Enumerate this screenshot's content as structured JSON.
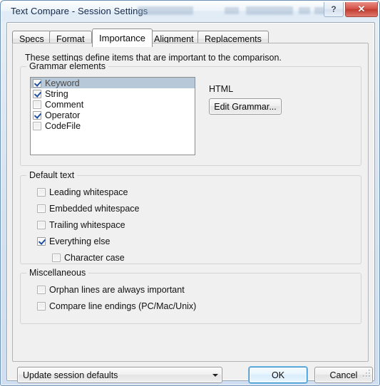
{
  "window": {
    "title": "Text Compare - Session Settings",
    "help_button": "?",
    "close_button": "✕",
    "help_icon": "question-mark-icon",
    "close_icon": "close-x-icon"
  },
  "tabs": [
    {
      "label": "Specs",
      "active": false
    },
    {
      "label": "Format",
      "active": false
    },
    {
      "label": "Importance",
      "active": true
    },
    {
      "label": "Alignment",
      "active": false
    },
    {
      "label": "Replacements",
      "active": false
    }
  ],
  "page": {
    "intro": "These settings define items that are important to the comparison."
  },
  "grammar_group": {
    "label": "Grammar elements",
    "items": [
      {
        "label": "Keyword",
        "checked": true,
        "selected": true
      },
      {
        "label": "String",
        "checked": true,
        "selected": false
      },
      {
        "label": "Comment",
        "checked": false,
        "selected": false
      },
      {
        "label": "Operator",
        "checked": true,
        "selected": false
      },
      {
        "label": "CodeFile",
        "checked": false,
        "selected": false
      }
    ],
    "grammar_name": "HTML",
    "edit_button": "Edit Grammar..."
  },
  "default_text_group": {
    "label": "Default text",
    "items": [
      {
        "label": "Leading whitespace",
        "checked": false,
        "indent": false
      },
      {
        "label": "Embedded whitespace",
        "checked": false,
        "indent": false
      },
      {
        "label": "Trailing whitespace",
        "checked": false,
        "indent": false
      },
      {
        "label": "Everything else",
        "checked": true,
        "indent": false
      },
      {
        "label": "Character case",
        "checked": false,
        "indent": true
      }
    ]
  },
  "misc_group": {
    "label": "Miscellaneous",
    "items": [
      {
        "label": "Orphan lines are always important",
        "checked": false
      },
      {
        "label": "Compare line endings (PC/Mac/Unix)",
        "checked": false
      }
    ]
  },
  "footer": {
    "session_combo_value": "Update session defaults",
    "ok_label": "OK",
    "cancel_label": "Cancel"
  },
  "colors": {
    "accent": "#2e8bc8",
    "selection": "#b7c8d9",
    "check": "#21519e",
    "close_red": "#c23d31",
    "title_text": "#13274a"
  }
}
